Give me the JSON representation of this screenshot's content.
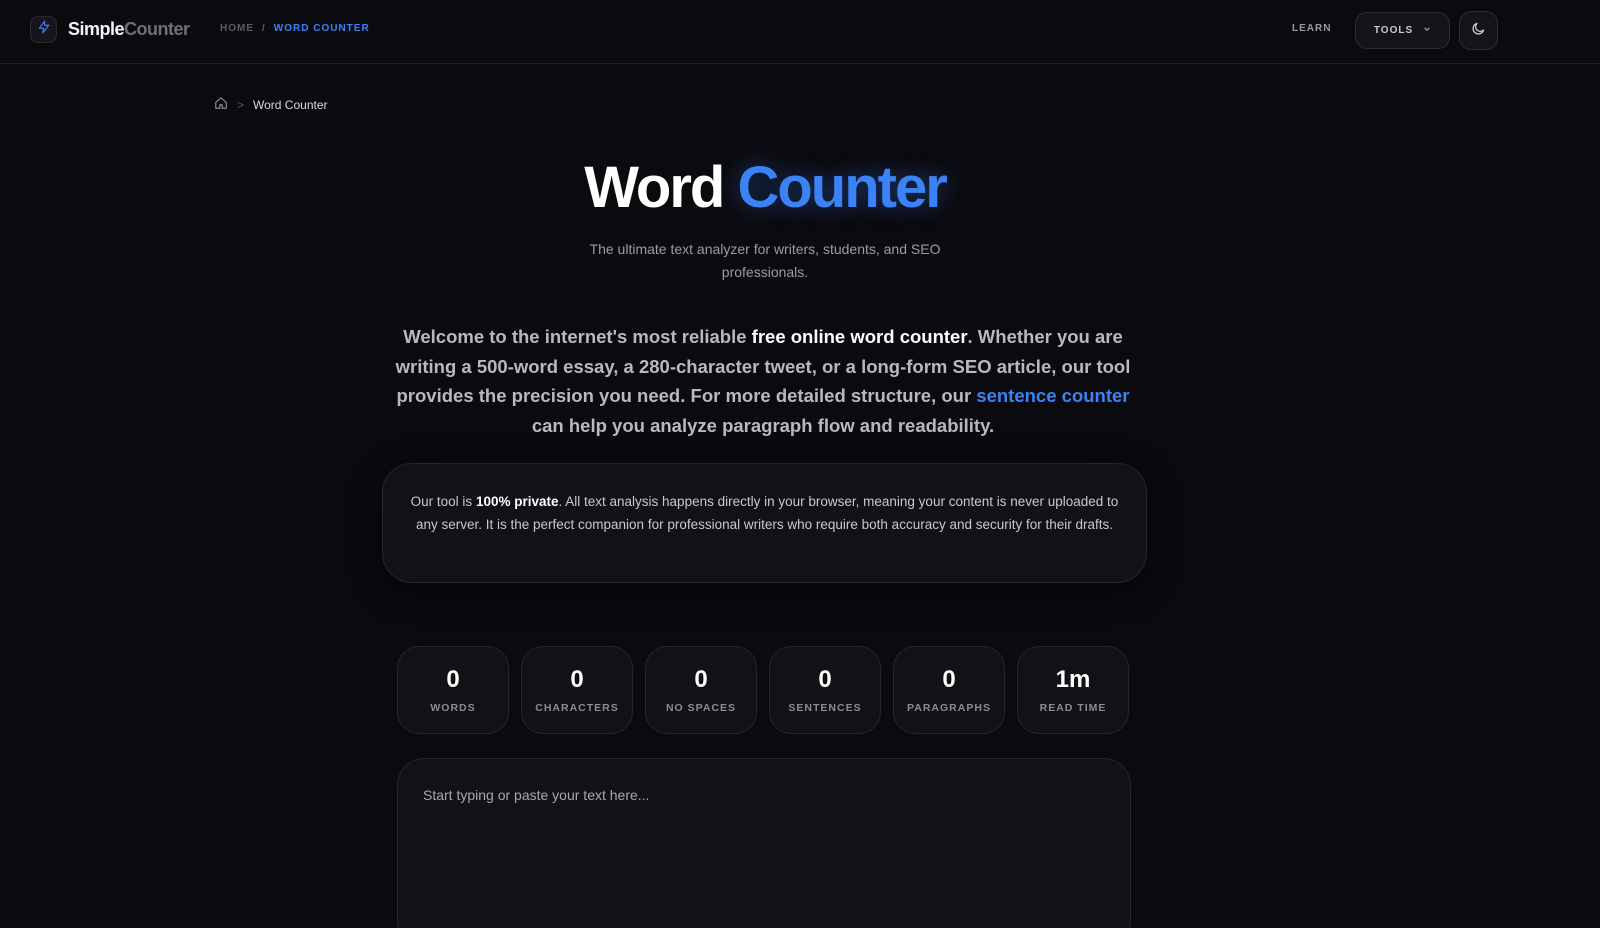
{
  "nav": {
    "brand_primary": "Simple",
    "brand_secondary": "Counter",
    "logo_icon": "bolt-icon",
    "crumb_home": "HOME",
    "crumb_separator": "/",
    "crumb_current": "WORD COUNTER",
    "learn_label": "LEARN",
    "tools_label": "TOOLS",
    "theme_icon": "moon-icon"
  },
  "breadcrumb": {
    "home_icon": "home-icon",
    "separator": ">",
    "current": "Word Counter"
  },
  "hero": {
    "title_part1": "Word",
    "title_part2": "Counter",
    "subtitle": "The ultimate text analyzer for writers, students, and SEO professionals."
  },
  "intro": {
    "text1": "Welcome to the internet's most reliable ",
    "bold": "free online word counter",
    "text2": ". Whether you are writing a 500-word essay, a 280-character tweet, or a long-form SEO article, our tool provides the precision you need. For more detailed structure, our ",
    "link": "sentence counter",
    "text3": " can help you analyze paragraph flow and readability."
  },
  "privacy": {
    "text1": "Our tool is ",
    "bold": "100% private",
    "text2": ". All text analysis happens directly in your browser, meaning your content is never uploaded to any server. It is the perfect companion for professional writers who require both accuracy and security for their drafts."
  },
  "stats": [
    {
      "value": "0",
      "label": "WORDS"
    },
    {
      "value": "0",
      "label": "CHARACTERS"
    },
    {
      "value": "0",
      "label": "NO SPACES"
    },
    {
      "value": "0",
      "label": "SENTENCES"
    },
    {
      "value": "0",
      "label": "PARAGRAPHS"
    },
    {
      "value": "1m",
      "label": "READ TIME"
    }
  ],
  "editor": {
    "placeholder": "Start typing or paste your text here...",
    "value": ""
  },
  "colors": {
    "background": "#0b0b0f",
    "accent": "#3b82f6",
    "card": "#111116"
  }
}
